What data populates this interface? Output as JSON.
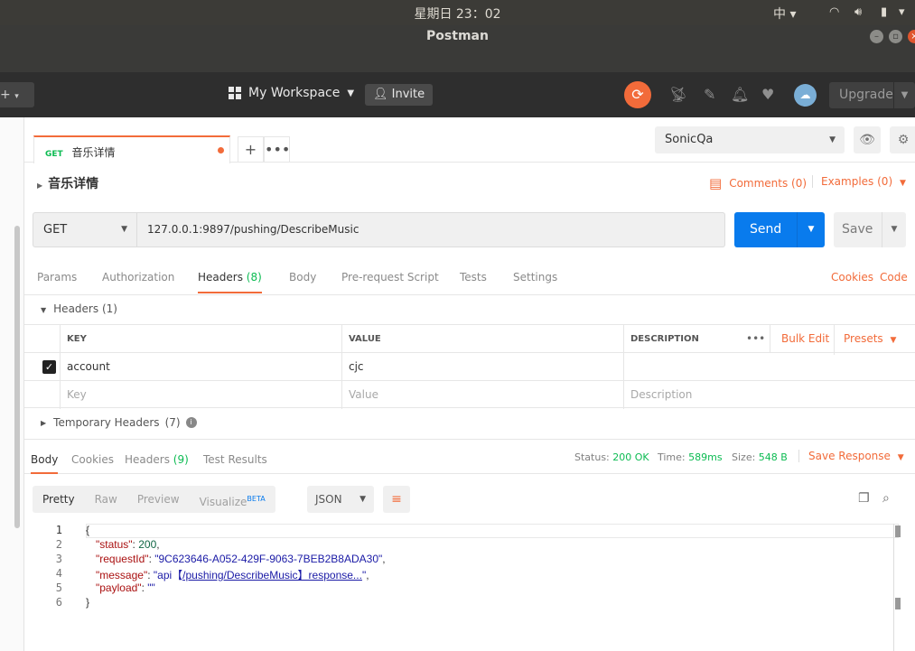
{
  "os": {
    "clock": "星期日 23：02",
    "ime": "中"
  },
  "window": {
    "title": "Postman"
  },
  "header": {
    "workspace": "My Workspace",
    "invite": "Invite",
    "upgrade": "Upgrade"
  },
  "tab": {
    "method": "GET",
    "name": "音乐详情"
  },
  "environment": {
    "selected": "SonicQa"
  },
  "request": {
    "name": "音乐详情",
    "comments": "Comments (0)",
    "examples": "Examples (0)",
    "method": "GET",
    "url": "127.0.0.1:9897/pushing/DescribeMusic",
    "send": "Send",
    "save": "Save"
  },
  "request_tabs": {
    "params": "Params",
    "authorization": "Authorization",
    "headers": "Headers",
    "headers_count": "(8)",
    "body": "Body",
    "prerequest": "Pre-request Script",
    "tests": "Tests",
    "settings": "Settings",
    "cookies": "Cookies",
    "code": "Code"
  },
  "headers_section": {
    "title": "Headers",
    "count": "(1)",
    "col_key": "KEY",
    "col_value": "VALUE",
    "col_description": "DESCRIPTION",
    "bulk_edit": "Bulk Edit",
    "presets": "Presets",
    "rows": [
      {
        "key": "account",
        "value": "cjc",
        "description": ""
      }
    ],
    "placeholder_key": "Key",
    "placeholder_value": "Value",
    "placeholder_description": "Description",
    "temporary": "Temporary Headers",
    "temporary_count": "(7)"
  },
  "response": {
    "tabs": {
      "body": "Body",
      "cookies": "Cookies",
      "headers": "Headers",
      "headers_count": "(9)",
      "tests": "Test Results"
    },
    "status_label": "Status:",
    "status_value": "200 OK",
    "time_label": "Time:",
    "time_value": "589ms",
    "size_label": "Size:",
    "size_value": "548 B",
    "save_response": "Save Response",
    "format": {
      "pretty": "Pretty",
      "raw": "Raw",
      "preview": "Preview",
      "visualize": "Visualize",
      "beta": "BETA",
      "type": "JSON"
    },
    "code": {
      "line_numbers": [
        "1",
        "2",
        "3",
        "4",
        "5",
        "6"
      ],
      "open": "{",
      "close": "}",
      "status_key": "\"status\"",
      "status_val": "200",
      "requestId_key": "\"requestId\"",
      "requestId_val": "\"9C623646-A052-429F-9063-7BEB2B8ADA30\"",
      "message_key": "\"message\"",
      "message_pre": "\"api【",
      "message_link": "/pushing/DescribeMusic】response...",
      "message_post": "\"",
      "payload_key": "\"payload\"",
      "payload_val": "\"\""
    }
  },
  "colors": {
    "accent": "#f26b3a",
    "send": "#097bed",
    "success": "#0cbb52"
  }
}
